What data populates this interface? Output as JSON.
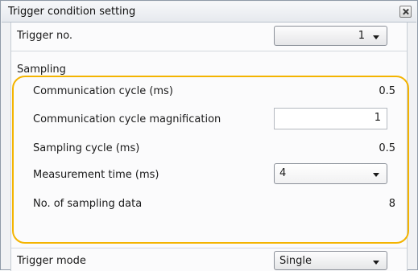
{
  "window": {
    "title": "Trigger condition setting",
    "close_icon": "close-icon"
  },
  "trigger_no": {
    "label": "Trigger no.",
    "value": "1"
  },
  "sampling": {
    "header": "Sampling",
    "communication_cycle": {
      "label": "Communication cycle (ms)",
      "value": "0.5"
    },
    "communication_cycle_magnification": {
      "label": "Communication cycle magnification",
      "value": "1"
    },
    "sampling_cycle": {
      "label": "Sampling cycle (ms)",
      "value": "0.5"
    },
    "measurement_time": {
      "label": "Measurement time (ms)",
      "value": "4"
    },
    "sampling_data": {
      "label": "No. of sampling data",
      "value": "8"
    }
  },
  "trigger_mode": {
    "label": "Trigger mode",
    "value": "Single"
  },
  "colors": {
    "highlight_outline": "#f4b400",
    "panel_background": "#f1f2f4",
    "content_background": "#fbfbfc"
  }
}
